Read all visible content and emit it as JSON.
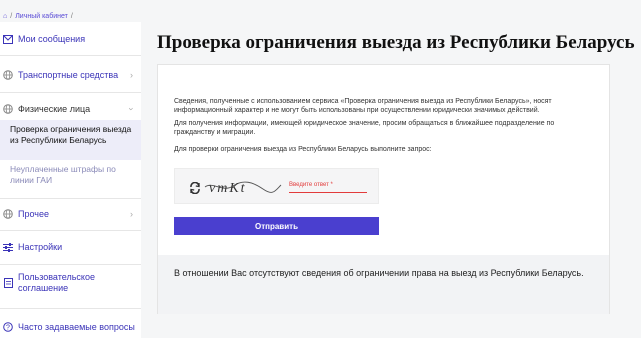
{
  "breadcrumb": {
    "home": "⌂",
    "sep1": "/",
    "cabinet": "Личный кабинет",
    "sep2": "/"
  },
  "sidebar": {
    "messages": "Мои сообщения",
    "vehicles": "Транспортные средства",
    "individuals": "Физические лица",
    "exit_check": "Проверка ограничения выезда из Республики Беларусь",
    "fines": "Неуплаченные штрафы по линии ГАИ",
    "other": "Прочее",
    "settings": "Настройки",
    "agreement": "Пользовательское соглашение",
    "faq": "Часто задаваемые вопросы"
  },
  "main": {
    "title": "Проверка ограничения выезда из Республики Беларусь",
    "info1": "Сведения, полученные с использованием сервиса «Проверка ограничения выезда из Республики Беларусь», носят информационный характер и не могут быть использованы при осуществлении юридически значимых действий.",
    "info2": "Для получения информации, имеющей юридическое значение, просим обращаться в ближайшее подразделение по гражданству и миграции.",
    "info3": "Для проверки ограничения выезда из Республики Беларусь выполните запрос:",
    "captcha_text": "vmKt",
    "answer_placeholder": "Введите ответ *",
    "submit": "Отправить",
    "result": "В отношении Вас отсутствуют сведения об ограничении права на выезд из Республики Беларусь."
  },
  "colors": {
    "accent": "#4a3fcf",
    "link": "#3b34b8",
    "error": "#e23b3b"
  }
}
